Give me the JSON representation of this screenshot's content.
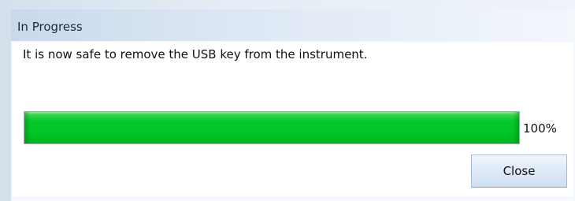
{
  "dialog": {
    "title": "In Progress",
    "message": "It is now safe to remove the USB key from the instrument.",
    "progress": {
      "value_percent": 100,
      "label": "100%",
      "fill_color": "#00c526"
    },
    "close_label": "Close"
  }
}
